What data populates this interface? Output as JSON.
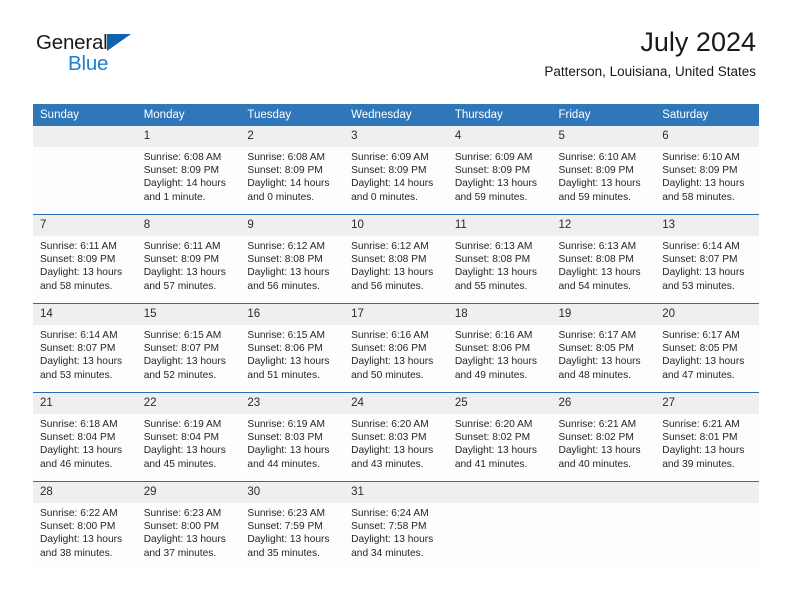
{
  "brand": {
    "name_line1": "General",
    "name_line2": "Blue",
    "triangle_color": "#1062b0",
    "blue_color": "#1b7fd4"
  },
  "header": {
    "title": "July 2024",
    "subtitle": "Patterson, Louisiana, United States"
  },
  "theme": {
    "header_bg": "#3077b9",
    "week_border": "#2a6cb0",
    "daynum_bg": "#efefef"
  },
  "calendar": {
    "weekday_headers": [
      "Sunday",
      "Monday",
      "Tuesday",
      "Wednesday",
      "Thursday",
      "Friday",
      "Saturday"
    ],
    "weeks": [
      [
        {
          "day": "",
          "empty": true,
          "sunrise": "",
          "sunset": "",
          "daylight_line1": "",
          "daylight_line2": ""
        },
        {
          "day": "1",
          "sunrise": "Sunrise: 6:08 AM",
          "sunset": "Sunset: 8:09 PM",
          "daylight_line1": "Daylight: 14 hours",
          "daylight_line2": "and 1 minute."
        },
        {
          "day": "2",
          "sunrise": "Sunrise: 6:08 AM",
          "sunset": "Sunset: 8:09 PM",
          "daylight_line1": "Daylight: 14 hours",
          "daylight_line2": "and 0 minutes."
        },
        {
          "day": "3",
          "sunrise": "Sunrise: 6:09 AM",
          "sunset": "Sunset: 8:09 PM",
          "daylight_line1": "Daylight: 14 hours",
          "daylight_line2": "and 0 minutes."
        },
        {
          "day": "4",
          "sunrise": "Sunrise: 6:09 AM",
          "sunset": "Sunset: 8:09 PM",
          "daylight_line1": "Daylight: 13 hours",
          "daylight_line2": "and 59 minutes."
        },
        {
          "day": "5",
          "sunrise": "Sunrise: 6:10 AM",
          "sunset": "Sunset: 8:09 PM",
          "daylight_line1": "Daylight: 13 hours",
          "daylight_line2": "and 59 minutes."
        },
        {
          "day": "6",
          "sunrise": "Sunrise: 6:10 AM",
          "sunset": "Sunset: 8:09 PM",
          "daylight_line1": "Daylight: 13 hours",
          "daylight_line2": "and 58 minutes."
        }
      ],
      [
        {
          "day": "7",
          "sunrise": "Sunrise: 6:11 AM",
          "sunset": "Sunset: 8:09 PM",
          "daylight_line1": "Daylight: 13 hours",
          "daylight_line2": "and 58 minutes."
        },
        {
          "day": "8",
          "sunrise": "Sunrise: 6:11 AM",
          "sunset": "Sunset: 8:09 PM",
          "daylight_line1": "Daylight: 13 hours",
          "daylight_line2": "and 57 minutes."
        },
        {
          "day": "9",
          "sunrise": "Sunrise: 6:12 AM",
          "sunset": "Sunset: 8:08 PM",
          "daylight_line1": "Daylight: 13 hours",
          "daylight_line2": "and 56 minutes."
        },
        {
          "day": "10",
          "sunrise": "Sunrise: 6:12 AM",
          "sunset": "Sunset: 8:08 PM",
          "daylight_line1": "Daylight: 13 hours",
          "daylight_line2": "and 56 minutes."
        },
        {
          "day": "11",
          "sunrise": "Sunrise: 6:13 AM",
          "sunset": "Sunset: 8:08 PM",
          "daylight_line1": "Daylight: 13 hours",
          "daylight_line2": "and 55 minutes."
        },
        {
          "day": "12",
          "sunrise": "Sunrise: 6:13 AM",
          "sunset": "Sunset: 8:08 PM",
          "daylight_line1": "Daylight: 13 hours",
          "daylight_line2": "and 54 minutes."
        },
        {
          "day": "13",
          "sunrise": "Sunrise: 6:14 AM",
          "sunset": "Sunset: 8:07 PM",
          "daylight_line1": "Daylight: 13 hours",
          "daylight_line2": "and 53 minutes."
        }
      ],
      [
        {
          "day": "14",
          "sunrise": "Sunrise: 6:14 AM",
          "sunset": "Sunset: 8:07 PM",
          "daylight_line1": "Daylight: 13 hours",
          "daylight_line2": "and 53 minutes."
        },
        {
          "day": "15",
          "sunrise": "Sunrise: 6:15 AM",
          "sunset": "Sunset: 8:07 PM",
          "daylight_line1": "Daylight: 13 hours",
          "daylight_line2": "and 52 minutes."
        },
        {
          "day": "16",
          "sunrise": "Sunrise: 6:15 AM",
          "sunset": "Sunset: 8:06 PM",
          "daylight_line1": "Daylight: 13 hours",
          "daylight_line2": "and 51 minutes."
        },
        {
          "day": "17",
          "sunrise": "Sunrise: 6:16 AM",
          "sunset": "Sunset: 8:06 PM",
          "daylight_line1": "Daylight: 13 hours",
          "daylight_line2": "and 50 minutes."
        },
        {
          "day": "18",
          "sunrise": "Sunrise: 6:16 AM",
          "sunset": "Sunset: 8:06 PM",
          "daylight_line1": "Daylight: 13 hours",
          "daylight_line2": "and 49 minutes."
        },
        {
          "day": "19",
          "sunrise": "Sunrise: 6:17 AM",
          "sunset": "Sunset: 8:05 PM",
          "daylight_line1": "Daylight: 13 hours",
          "daylight_line2": "and 48 minutes."
        },
        {
          "day": "20",
          "sunrise": "Sunrise: 6:17 AM",
          "sunset": "Sunset: 8:05 PM",
          "daylight_line1": "Daylight: 13 hours",
          "daylight_line2": "and 47 minutes."
        }
      ],
      [
        {
          "day": "21",
          "sunrise": "Sunrise: 6:18 AM",
          "sunset": "Sunset: 8:04 PM",
          "daylight_line1": "Daylight: 13 hours",
          "daylight_line2": "and 46 minutes."
        },
        {
          "day": "22",
          "sunrise": "Sunrise: 6:19 AM",
          "sunset": "Sunset: 8:04 PM",
          "daylight_line1": "Daylight: 13 hours",
          "daylight_line2": "and 45 minutes."
        },
        {
          "day": "23",
          "sunrise": "Sunrise: 6:19 AM",
          "sunset": "Sunset: 8:03 PM",
          "daylight_line1": "Daylight: 13 hours",
          "daylight_line2": "and 44 minutes."
        },
        {
          "day": "24",
          "sunrise": "Sunrise: 6:20 AM",
          "sunset": "Sunset: 8:03 PM",
          "daylight_line1": "Daylight: 13 hours",
          "daylight_line2": "and 43 minutes."
        },
        {
          "day": "25",
          "sunrise": "Sunrise: 6:20 AM",
          "sunset": "Sunset: 8:02 PM",
          "daylight_line1": "Daylight: 13 hours",
          "daylight_line2": "and 41 minutes."
        },
        {
          "day": "26",
          "sunrise": "Sunrise: 6:21 AM",
          "sunset": "Sunset: 8:02 PM",
          "daylight_line1": "Daylight: 13 hours",
          "daylight_line2": "and 40 minutes."
        },
        {
          "day": "27",
          "sunrise": "Sunrise: 6:21 AM",
          "sunset": "Sunset: 8:01 PM",
          "daylight_line1": "Daylight: 13 hours",
          "daylight_line2": "and 39 minutes."
        }
      ],
      [
        {
          "day": "28",
          "sunrise": "Sunrise: 6:22 AM",
          "sunset": "Sunset: 8:00 PM",
          "daylight_line1": "Daylight: 13 hours",
          "daylight_line2": "and 38 minutes."
        },
        {
          "day": "29",
          "sunrise": "Sunrise: 6:23 AM",
          "sunset": "Sunset: 8:00 PM",
          "daylight_line1": "Daylight: 13 hours",
          "daylight_line2": "and 37 minutes."
        },
        {
          "day": "30",
          "sunrise": "Sunrise: 6:23 AM",
          "sunset": "Sunset: 7:59 PM",
          "daylight_line1": "Daylight: 13 hours",
          "daylight_line2": "and 35 minutes."
        },
        {
          "day": "31",
          "sunrise": "Sunrise: 6:24 AM",
          "sunset": "Sunset: 7:58 PM",
          "daylight_line1": "Daylight: 13 hours",
          "daylight_line2": "and 34 minutes."
        },
        {
          "day": "",
          "empty": true,
          "sunrise": "",
          "sunset": "",
          "daylight_line1": "",
          "daylight_line2": ""
        },
        {
          "day": "",
          "empty": true,
          "sunrise": "",
          "sunset": "",
          "daylight_line1": "",
          "daylight_line2": ""
        },
        {
          "day": "",
          "empty": true,
          "sunrise": "",
          "sunset": "",
          "daylight_line1": "",
          "daylight_line2": ""
        }
      ]
    ]
  }
}
